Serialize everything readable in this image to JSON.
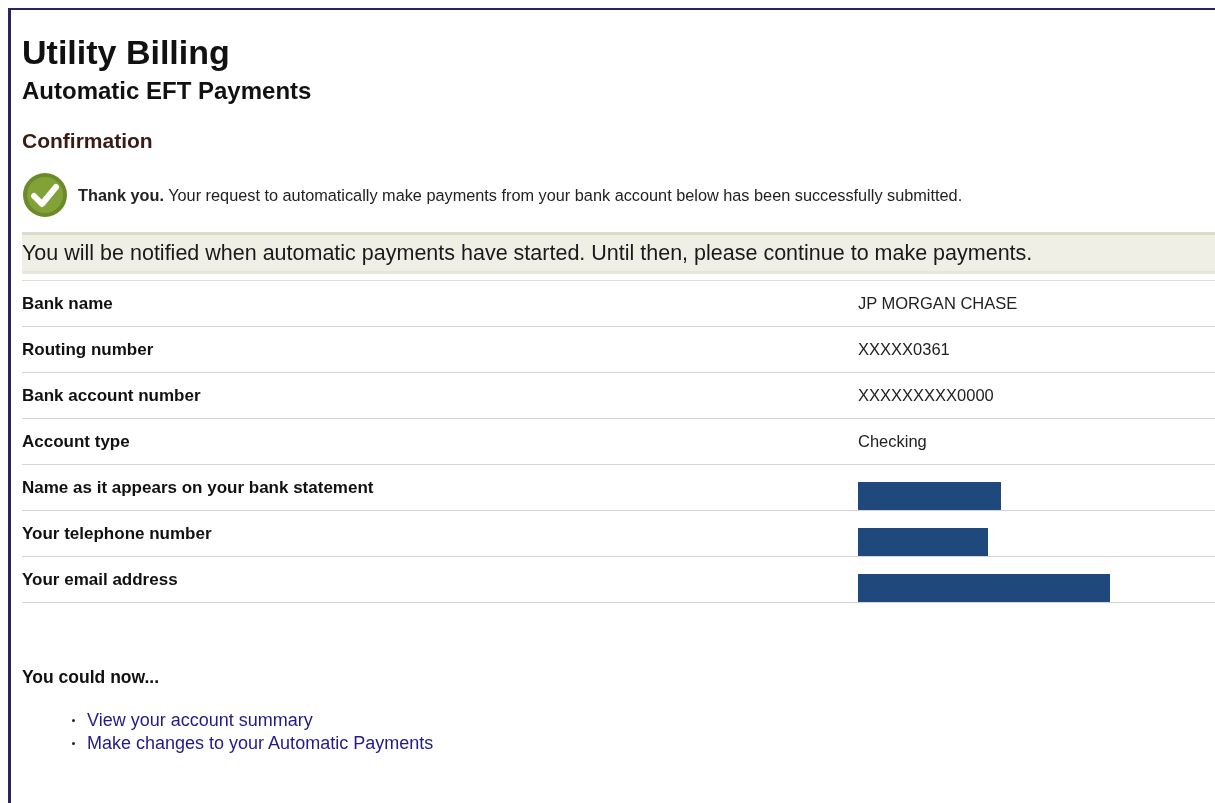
{
  "title": "Utility Billing",
  "subtitle": "Automatic EFT Payments",
  "section": "Confirmation",
  "confirmation": {
    "lead": "Thank you.",
    "message": "Your request to automatically make payments from your bank account below has been successfully submitted."
  },
  "notice": "You will be notified when automatic payments have started. Until then, please continue to make payments.",
  "details": [
    {
      "label": "Bank name",
      "value": "JP MORGAN CHASE",
      "redacted": false
    },
    {
      "label": "Routing number",
      "value": "XXXXX0361",
      "redacted": false
    },
    {
      "label": "Bank account number",
      "value": "XXXXXXXXX0000",
      "redacted": false
    },
    {
      "label": "Account type",
      "value": "Checking",
      "redacted": false
    },
    {
      "label": "Name as it appears on your bank statement",
      "redacted": true
    },
    {
      "label": "Your telephone number",
      "redacted": true
    },
    {
      "label": "Your email address",
      "redacted": true
    }
  ],
  "next_steps": {
    "heading": "You could now...",
    "links": [
      "View your account summary",
      "Make changes to your Automatic Payments"
    ]
  }
}
